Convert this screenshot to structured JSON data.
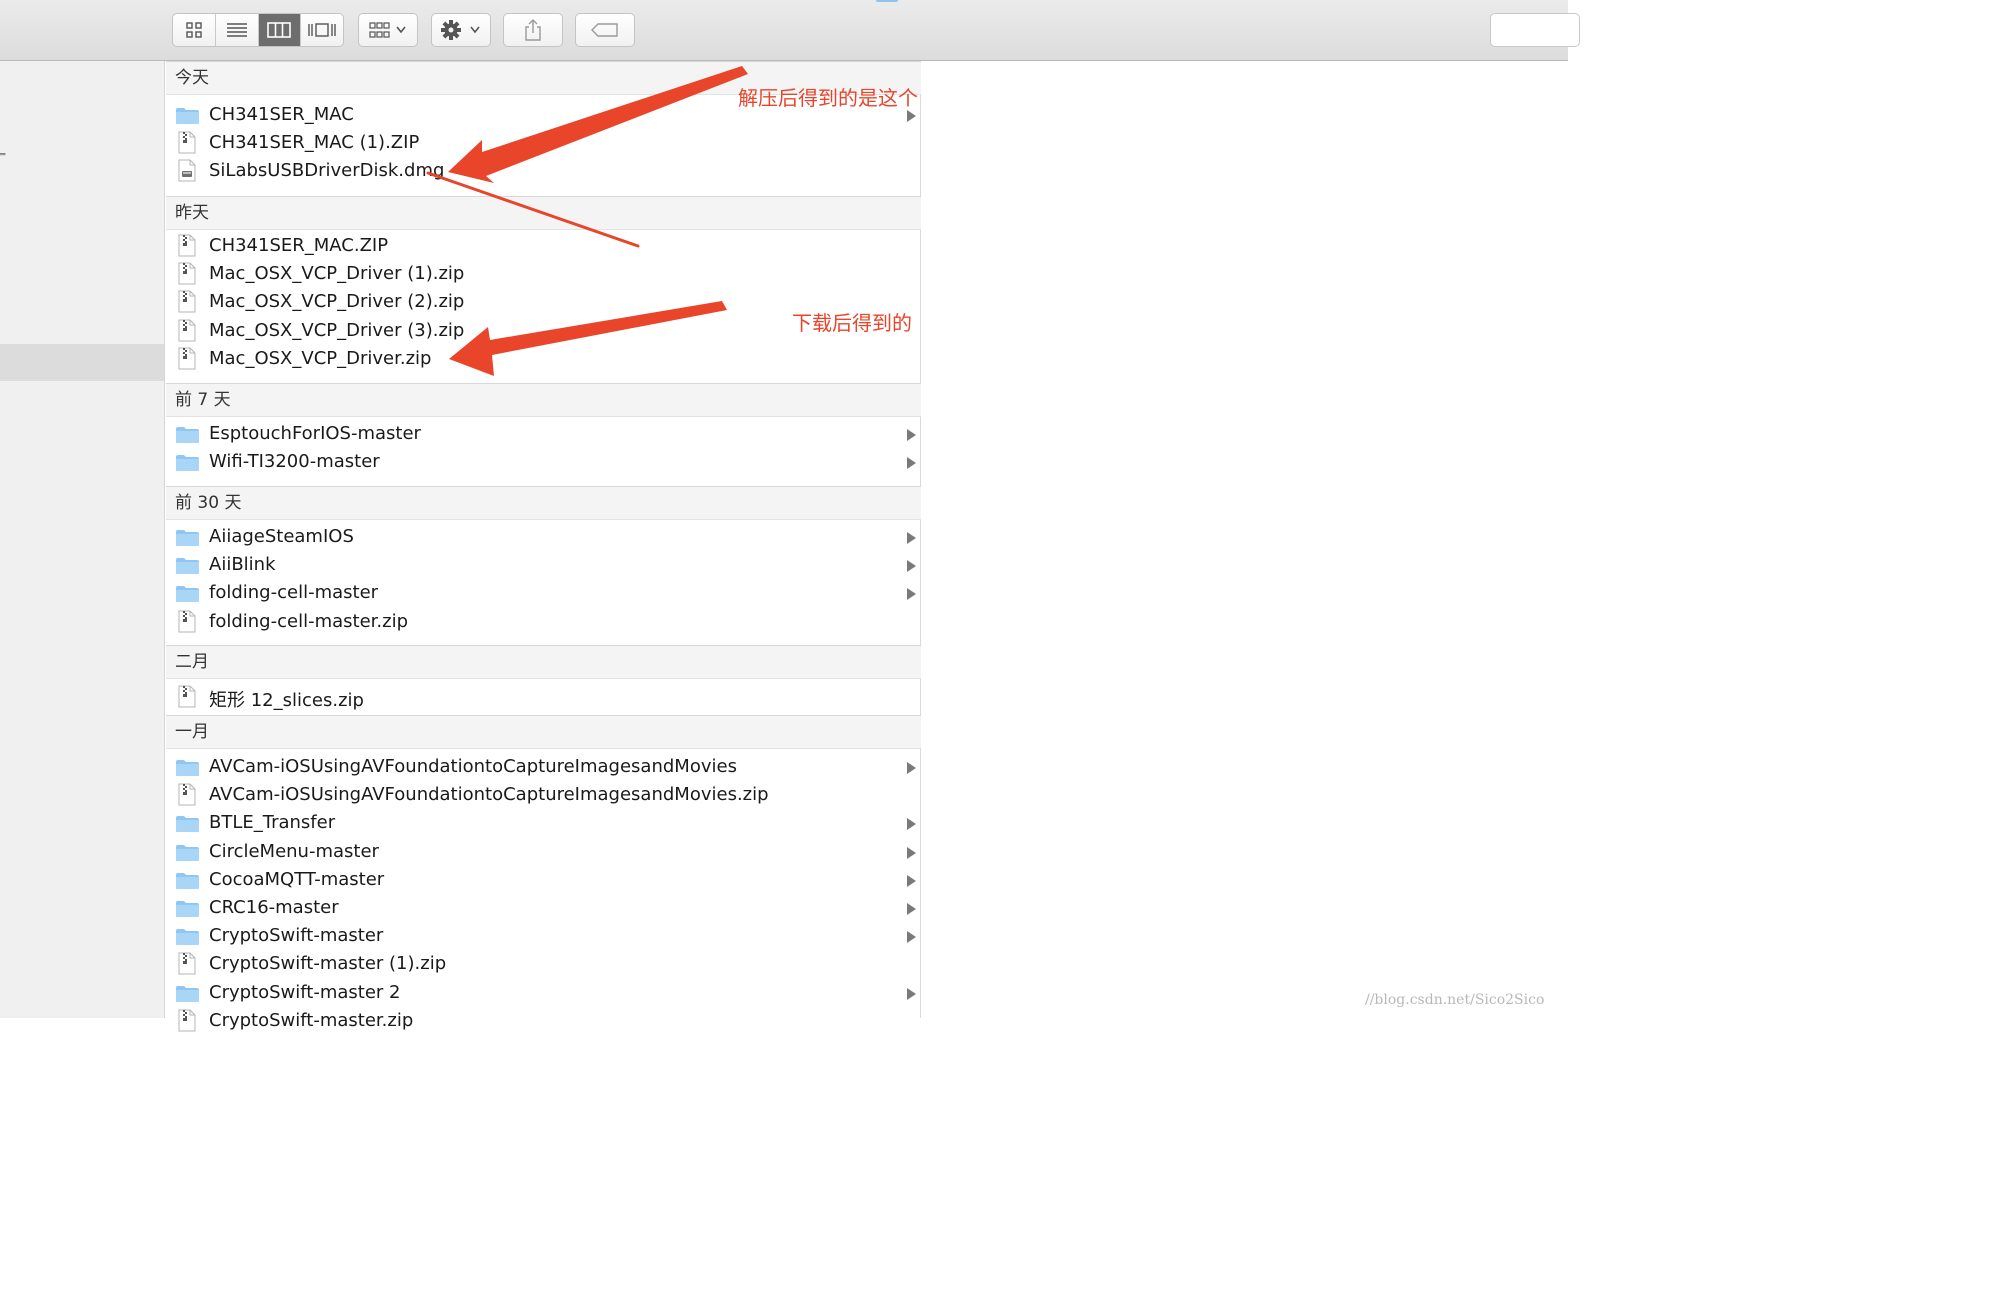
{
  "toolbar": {
    "view_buttons": [
      "icon-view",
      "list-view",
      "column-view",
      "cover-flow-view"
    ],
    "active_view": "column-view",
    "arrange_icon": "arrange-grid-icon",
    "action_icon": "gear-icon",
    "share_icon": "share-icon",
    "tag_icon": "tag-icon"
  },
  "groups": [
    {
      "header": "今天",
      "items": [
        {
          "name": "CH341SER_MAC",
          "kind": "folder",
          "has_children": true
        },
        {
          "name": "CH341SER_MAC (1).ZIP",
          "kind": "zip",
          "has_children": false
        },
        {
          "name": "SiLabsUSBDriverDisk.dmg",
          "kind": "dmg",
          "has_children": false
        }
      ]
    },
    {
      "header": "昨天",
      "items": [
        {
          "name": "CH341SER_MAC.ZIP",
          "kind": "zip",
          "has_children": false
        },
        {
          "name": "Mac_OSX_VCP_Driver (1).zip",
          "kind": "zip",
          "has_children": false
        },
        {
          "name": "Mac_OSX_VCP_Driver (2).zip",
          "kind": "zip",
          "has_children": false
        },
        {
          "name": "Mac_OSX_VCP_Driver (3).zip",
          "kind": "zip",
          "has_children": false
        },
        {
          "name": "Mac_OSX_VCP_Driver.zip",
          "kind": "zip",
          "has_children": false
        }
      ]
    },
    {
      "header": "前 7 天",
      "items": [
        {
          "name": "EsptouchForIOS-master",
          "kind": "folder",
          "has_children": true
        },
        {
          "name": "Wifi-TI3200-master",
          "kind": "folder",
          "has_children": true
        }
      ]
    },
    {
      "header": "前 30 天",
      "items": [
        {
          "name": "AiiageSteamIOS",
          "kind": "folder",
          "has_children": true
        },
        {
          "name": "AiiBlink",
          "kind": "folder",
          "has_children": true
        },
        {
          "name": "folding-cell-master",
          "kind": "folder",
          "has_children": true
        },
        {
          "name": "folding-cell-master.zip",
          "kind": "zip",
          "has_children": false
        }
      ]
    },
    {
      "header": "二月",
      "items": [
        {
          "name": "矩形 12_slices.zip",
          "kind": "zip",
          "has_children": false
        }
      ]
    },
    {
      "header": "一月",
      "items": [
        {
          "name": "AVCam-iOSUsingAVFoundationtoCaptureImagesandMovies",
          "kind": "folder",
          "has_children": true
        },
        {
          "name": "AVCam-iOSUsingAVFoundationtoCaptureImagesandMovies.zip",
          "kind": "zip",
          "has_children": false
        },
        {
          "name": "BTLE_Transfer",
          "kind": "folder",
          "has_children": true
        },
        {
          "name": "CircleMenu-master",
          "kind": "folder",
          "has_children": true
        },
        {
          "name": "CocoaMQTT-master",
          "kind": "folder",
          "has_children": true
        },
        {
          "name": "CRC16-master",
          "kind": "folder",
          "has_children": true
        },
        {
          "name": "CryptoSwift-master",
          "kind": "folder",
          "has_children": true
        },
        {
          "name": "CryptoSwift-master (1).zip",
          "kind": "zip",
          "has_children": false
        },
        {
          "name": "CryptoSwift-master 2",
          "kind": "folder",
          "has_children": true
        },
        {
          "name": "CryptoSwift-master.zip",
          "kind": "zip",
          "has_children": false
        }
      ]
    }
  ],
  "annotations": {
    "unzipped": "解压后得到的是这个",
    "downloaded": "下载后得到的"
  },
  "colors": {
    "annotation": "#e8452b",
    "folder": "#8ec7f2"
  },
  "watermark": "//blog.csdn.net/Sico2Sico"
}
